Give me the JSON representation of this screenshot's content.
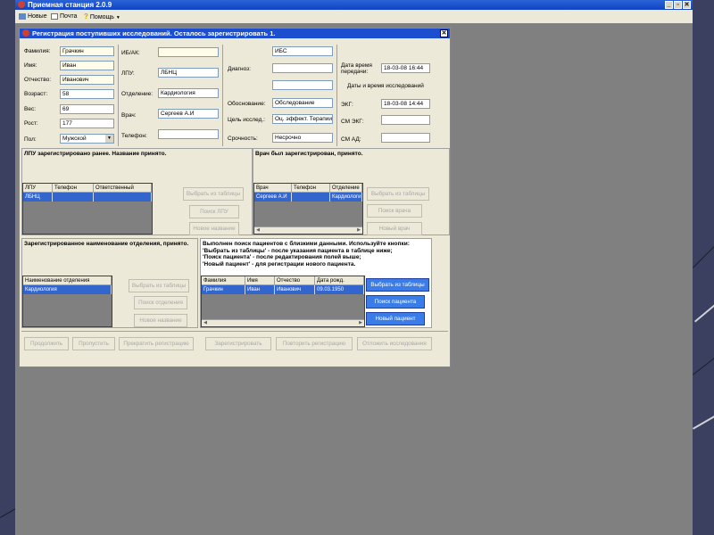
{
  "app": {
    "title": "Приемная станция 2.0.9",
    "menu": {
      "new": "Новые",
      "mail": "Почта",
      "help": "Помощь"
    }
  },
  "dialog": {
    "title": "Регистрация поступивших исследований. Осталось зарегистрировать 1.",
    "patient": {
      "lastname_label": "Фамилия:",
      "lastname": "Грачкин",
      "firstname_label": "Имя:",
      "firstname": "Иван",
      "patronymic_label": "Отчество:",
      "patronymic": "Иванович",
      "age_label": "Возраст:",
      "age": "58",
      "weight_label": "Вес:",
      "weight": "69",
      "height_label": "Рост:",
      "height": "177",
      "sex_label": "Пол:",
      "sex": "Мужской"
    },
    "referral": {
      "ib_label": "ИБ/АК:",
      "ib": "",
      "lpu_label": "ЛПУ:",
      "lpu": "ЛБНЦ",
      "department_label": "Отделение:",
      "department": "Кардиология",
      "doctor_label": "Врач:",
      "doctor": "Сергеев А.И",
      "phone_label": "Телефон:",
      "phone": ""
    },
    "exam": {
      "diagnosis_top": "ИБС",
      "diagnosis_label": "Диагноз:",
      "diagnosis_1": "",
      "diagnosis_2": "",
      "basis_label": "Обоснование:",
      "basis": "Обследование",
      "goal_label": "Цель исслед.:",
      "goal": "Оц. эффект. Терапии",
      "urgency_label": "Срочность:",
      "urgency": "Несрочно"
    },
    "times": {
      "transfer_label": "Дата время передачи:",
      "transfer": "18-03-08 16:44",
      "exam_times_header": "Даты и время исследований",
      "ecg_label": "ЭКГ:",
      "ecg": "18-03-08 14:44",
      "sm_ecg_label": "СМ ЭКГ:",
      "sm_ecg": "",
      "sm_ad_label": "СМ АД:",
      "sm_ad": ""
    },
    "lpu_panel": {
      "message": "ЛПУ зарегистрировано ранее. Название принято.",
      "columns": [
        "ЛПУ",
        "Телефон",
        "Ответственный"
      ],
      "row": [
        "ЛБНЦ",
        "",
        ""
      ],
      "btn_select": "Выбрать из таблицы",
      "btn_search": "Поиск ЛПУ",
      "btn_new": "Новое название"
    },
    "doctor_panel": {
      "message": "Врач был зарегистрирован, принято.",
      "columns": [
        "Врач",
        "Телефон",
        "Отделение"
      ],
      "row": [
        "Сергеев А.И",
        "",
        "Кардиологи"
      ],
      "btn_select": "Выбрать из таблицы",
      "btn_search": "Поиск врача",
      "btn_new": "Новый врач"
    },
    "dept_panel": {
      "message": "Зарегистрированное наименование отделения, принято.",
      "columns": [
        "Наименование отделения"
      ],
      "row": [
        "Кардиология"
      ],
      "btn_select": "Выбрать из таблицы",
      "btn_search": "Поиск отделения",
      "btn_new": "Новое название"
    },
    "patient_panel": {
      "message_1": "Выполнен поиск пациентов с близкими данными. Используйте кнопки:",
      "message_2": "'Выбрать из таблицы' - после указания пациента в таблице ниже;",
      "message_3": "'Поиск пациента' - после редактирования полей выше;",
      "message_4": "'Новый пациент' - для регистрации нового пациента.",
      "columns": [
        "Фамилия",
        "Имя",
        "Отчество",
        "Дата рожд."
      ],
      "row": [
        "Грачкин",
        "Иван",
        "Иванович",
        "09.03.1950"
      ],
      "btn_select": "Выбрать из таблицы",
      "btn_search": "Поиск пациента",
      "btn_new": "Новый пациент"
    },
    "bottom": {
      "continue": "Продолжить",
      "skip": "Пропустить",
      "stop": "Прекратить регистрацию",
      "register": "Зарегистрировать",
      "repeat": "Повторить регистрацию",
      "reject": "Отложить исследования"
    }
  },
  "colors": {
    "title_bar": "#1c4fd0",
    "selected_row": "#3366cc",
    "active_button": "#3a7de8",
    "mdi_bg": "#808080"
  }
}
